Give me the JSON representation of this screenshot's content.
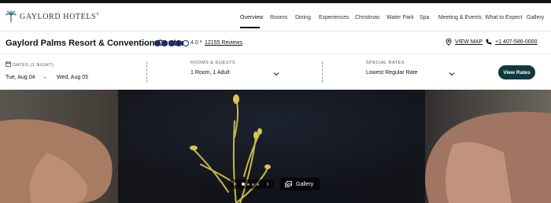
{
  "brand": {
    "name": "GAYLORD HOTELS",
    "trademark": "®"
  },
  "nav": {
    "items": [
      {
        "label": "Overview",
        "active": true
      },
      {
        "label": "Rooms"
      },
      {
        "label": "Dining"
      },
      {
        "label": "Experiences"
      },
      {
        "label": "Christmas"
      },
      {
        "label": "Water Park"
      },
      {
        "label": "Spa"
      },
      {
        "label": "Meeting & Events"
      },
      {
        "label": "What to Expect"
      },
      {
        "label": "Gallery"
      }
    ]
  },
  "hotel": {
    "name": "Gaylord Palms Resort & Convention Center",
    "rating": 4.0,
    "rating_text": "4.0",
    "rating_max": 5,
    "bullet": "•",
    "reviews": "12155 Reviews",
    "map_label": "VIEW MAP",
    "phone": "+1 407-586-0000"
  },
  "booking": {
    "dates_label": "DATES (1 NIGHT)",
    "check_in": "Tue, Aug 04",
    "arrow": "→",
    "check_out": "Wed, Aug 05",
    "rooms_label": "ROOMS & GUESTS",
    "rooms_value": "1 Room, 1 Adult",
    "rates_label": "SPECIAL RATES",
    "rates_value": "Lowest Regular Rate",
    "button": "View Rates"
  },
  "hero": {
    "prev": "‹",
    "next": "›",
    "slide_count": 4,
    "active_slide": 1,
    "gallery_label": "Gallery"
  },
  "colors": {
    "brand_dark": "#12383f",
    "rating_blue": "#1b2b6b"
  }
}
